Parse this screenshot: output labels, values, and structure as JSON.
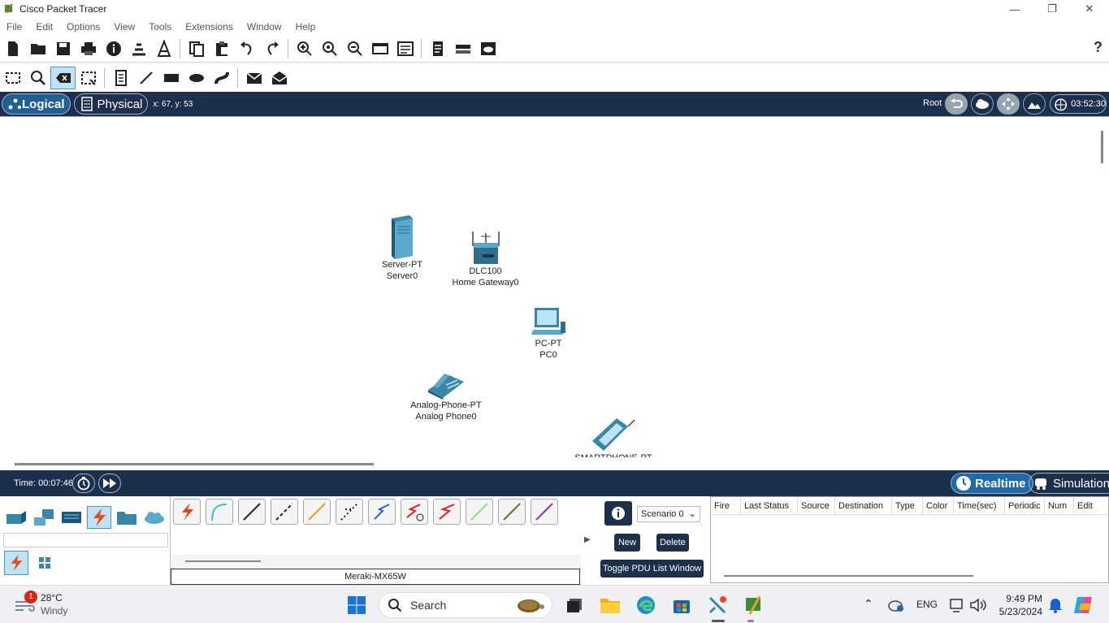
{
  "window": {
    "title": "Cisco Packet Tracer"
  },
  "menu": [
    "File",
    "Edit",
    "Options",
    "View",
    "Tools",
    "Extensions",
    "Window",
    "Help"
  ],
  "help_label": "?",
  "nav": {
    "logical": "Logical",
    "physical": "Physical",
    "coords": "x: 67, y: 53",
    "root": "Root",
    "clock": "03:52:30"
  },
  "devices": [
    {
      "type": "Server-PT",
      "name": "Server0",
      "icon": "server-icon"
    },
    {
      "type": "DLC100",
      "name": "Home Gateway0",
      "icon": "home-gateway-icon"
    },
    {
      "type": "PC-PT",
      "name": "PC0",
      "icon": "pc-icon"
    },
    {
      "type": "Analog-Phone-PT",
      "name": "Analog Phone0",
      "icon": "analog-phone-icon"
    },
    {
      "type": "SMARTPHONE-PT",
      "name": "",
      "icon": "smartphone-icon"
    }
  ],
  "timebar": {
    "time": "Time: 00:07:46",
    "realtime": "Realtime",
    "simulation": "Simulation"
  },
  "device_panel": {
    "selected_device_name": "Meraki-MX65W"
  },
  "scenario": {
    "selected": "Scenario 0",
    "new": "New",
    "delete": "Delete",
    "toggle": "Toggle PDU List Window",
    "info": "i"
  },
  "pdu_columns": [
    "Fire",
    "Last Status",
    "Source",
    "Destination",
    "Type",
    "Color",
    "Time(sec)",
    "Periodic",
    "Num",
    "Edit"
  ],
  "taskbar": {
    "weather_badge": "1",
    "temperature": "28°C",
    "condition": "Windy",
    "search": "Search",
    "lang": "ENG",
    "time": "9:49 PM",
    "date": "5/23/2024"
  },
  "colors": {
    "navy": "#1c2f4d",
    "accent": "#1f6ba8"
  }
}
